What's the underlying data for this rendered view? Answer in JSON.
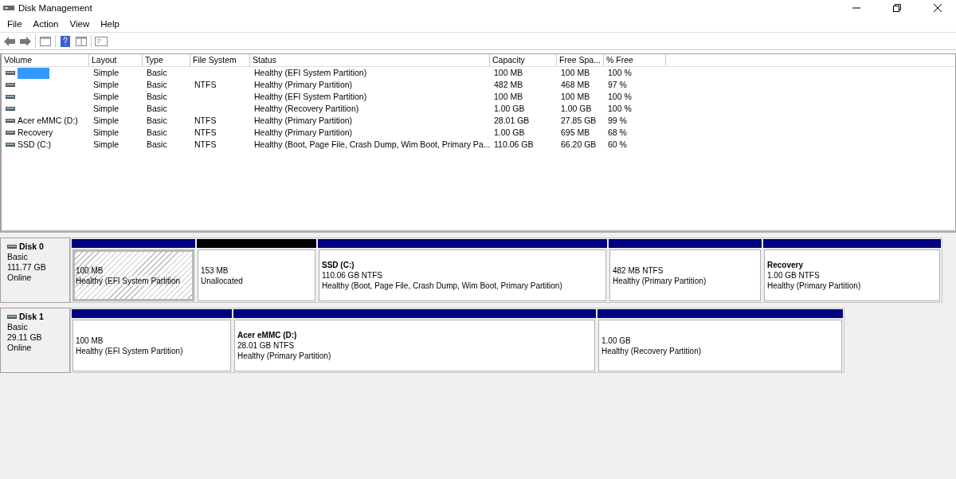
{
  "window": {
    "title": "Disk Management"
  },
  "menu": [
    "File",
    "Action",
    "View",
    "Help"
  ],
  "table": {
    "columns": [
      "Volume",
      "Layout",
      "Type",
      "File System",
      "Status",
      "Capacity",
      "Free Spa...",
      "% Free"
    ],
    "rows": [
      {
        "selected": true,
        "cells": [
          "",
          "Simple",
          "Basic",
          "",
          "Healthy (EFI System Partition)",
          "100 MB",
          "100 MB",
          "100 %"
        ]
      },
      {
        "selected": false,
        "cells": [
          "",
          "Simple",
          "Basic",
          "NTFS",
          "Healthy (Primary Partition)",
          "482 MB",
          "468 MB",
          "97 %"
        ]
      },
      {
        "selected": false,
        "cells": [
          "",
          "Simple",
          "Basic",
          "",
          "Healthy (EFI System Partition)",
          "100 MB",
          "100 MB",
          "100 %"
        ]
      },
      {
        "selected": false,
        "cells": [
          "",
          "Simple",
          "Basic",
          "",
          "Healthy (Recovery Partition)",
          "1.00 GB",
          "1.00 GB",
          "100 %"
        ]
      },
      {
        "selected": false,
        "cells": [
          "Acer eMMC (D:)",
          "Simple",
          "Basic",
          "NTFS",
          "Healthy (Primary Partition)",
          "28.01 GB",
          "27.85 GB",
          "99 %"
        ]
      },
      {
        "selected": false,
        "cells": [
          "Recovery",
          "Simple",
          "Basic",
          "NTFS",
          "Healthy (Primary Partition)",
          "1.00 GB",
          "695 MB",
          "68 %"
        ]
      },
      {
        "selected": false,
        "cells": [
          "SSD (C:)",
          "Simple",
          "Basic",
          "NTFS",
          "Healthy (Boot, Page File, Crash Dump, Wim Boot, Primary Pa...",
          "110.06 GB",
          "66.20 GB",
          "60 %"
        ]
      }
    ]
  },
  "disks": [
    {
      "name": "Disk 0",
      "type": "Basic",
      "size": "111.77 GB",
      "state": "Online",
      "partitions": [
        {
          "kind": "primary",
          "selected": true,
          "lines": [
            "100 MB",
            "Healthy (EFI System Partition"
          ]
        },
        {
          "kind": "unallocated",
          "selected": false,
          "lines": [
            "153 MB",
            "Unallocated"
          ]
        },
        {
          "kind": "primary",
          "selected": false,
          "label": "SSD  (C:)",
          "lines": [
            "110.06 GB NTFS",
            "Healthy (Boot, Page File, Crash Dump, Wim Boot, Primary Partition)"
          ]
        },
        {
          "kind": "primary",
          "selected": false,
          "lines": [
            "482 MB NTFS",
            "Healthy (Primary Partition)"
          ]
        },
        {
          "kind": "primary",
          "selected": false,
          "label": "Recovery",
          "lines": [
            "1.00 GB NTFS",
            "Healthy (Primary Partition)"
          ]
        }
      ]
    },
    {
      "name": "Disk 1",
      "type": "Basic",
      "size": "29.11 GB",
      "state": "Online",
      "partitions": [
        {
          "kind": "primary",
          "selected": false,
          "lines": [
            "100 MB",
            "Healthy (EFI System Partition)"
          ]
        },
        {
          "kind": "primary",
          "selected": false,
          "label": "Acer eMMC  (D:)",
          "lines": [
            "28.01 GB NTFS",
            "Healthy (Primary Partition)"
          ]
        },
        {
          "kind": "primary",
          "selected": false,
          "lines": [
            "1.00 GB",
            "Healthy (Recovery Partition)"
          ]
        }
      ]
    }
  ]
}
